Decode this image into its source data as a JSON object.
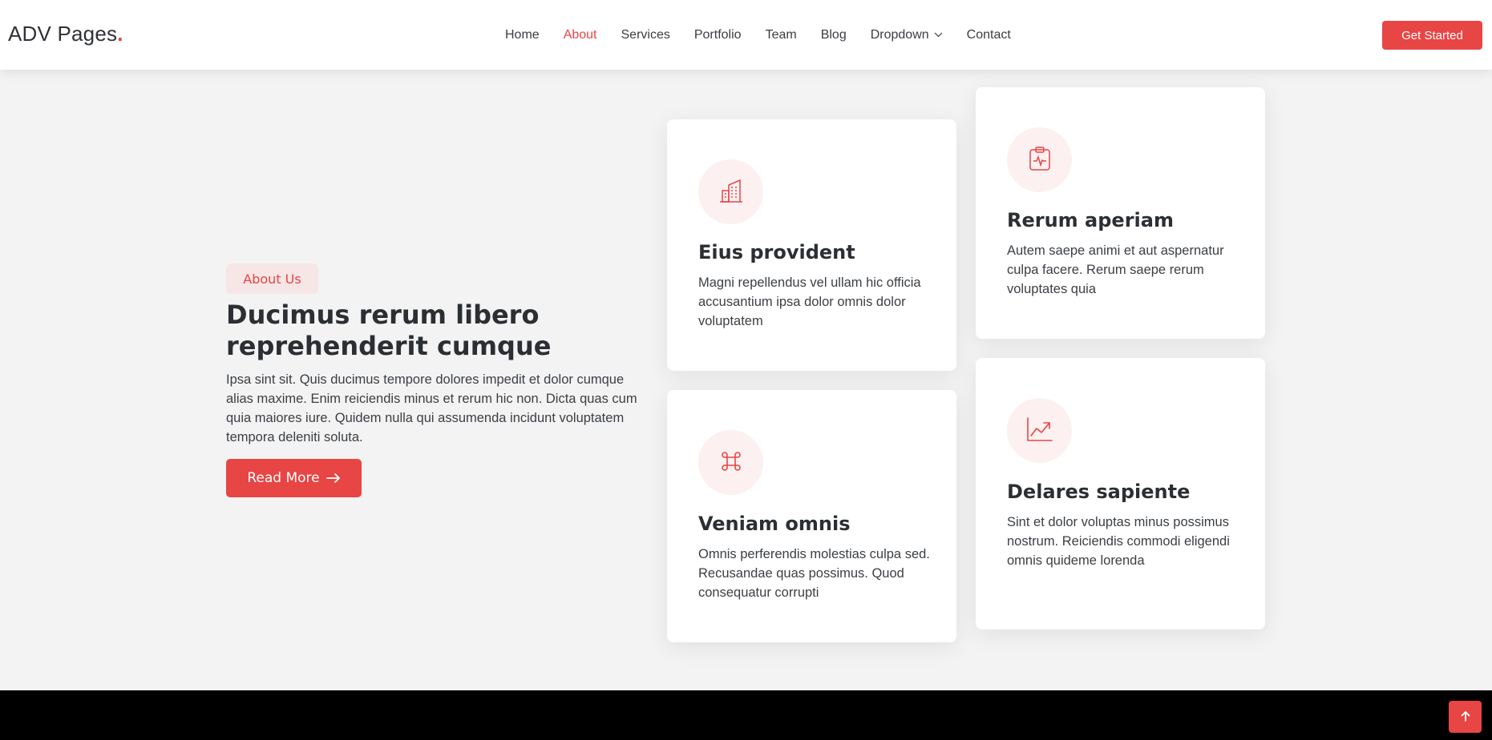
{
  "header": {
    "logo_text": "ADV Pages",
    "logo_dot": ".",
    "nav": [
      {
        "label": "Home",
        "active": false
      },
      {
        "label": "About",
        "active": true
      },
      {
        "label": "Services",
        "active": false
      },
      {
        "label": "Portfolio",
        "active": false
      },
      {
        "label": "Team",
        "active": false
      },
      {
        "label": "Blog",
        "active": false
      },
      {
        "label": "Dropdown",
        "active": false
      },
      {
        "label": "Contact",
        "active": false
      }
    ],
    "cta_label": "Get Started"
  },
  "about": {
    "badge": "About Us",
    "title": "Ducimus rerum libero reprehenderit cumque",
    "text": "Ipsa sint sit. Quis ducimus tempore dolores impedit et dolor cumque alias maxime. Enim reiciendis minus et rerum hic non. Dicta quas cum quia maiores iure. Quidem nulla qui assumenda incidunt voluptatem tempora deleniti soluta.",
    "button_label": "Read More"
  },
  "cards": [
    {
      "icon": "buildings-icon",
      "title": "Eius provident",
      "text": "Magni repellendus vel ullam hic officia accusantium ipsa dolor omnis dolor voluptatem"
    },
    {
      "icon": "clipboard-pulse-icon",
      "title": "Rerum aperiam",
      "text": "Autem saepe animi et aut aspernatur culpa facere. Rerum saepe rerum voluptates quia"
    },
    {
      "icon": "command-icon",
      "title": "Veniam omnis",
      "text": "Omnis perferendis molestias culpa sed. Recusandae quas possimus. Quod consequatur corrupti"
    },
    {
      "icon": "graph-up-arrow-icon",
      "title": "Delares sapiente",
      "text": "Sint et dolor voluptas minus possimus nostrum. Reiciendis commodi eligendi omnis quideme lorenda"
    }
  ],
  "colors": {
    "accent": "#e84545",
    "background": "#f3f3f3",
    "icon_circle": "#fdf0f0",
    "footer": "#000000"
  },
  "scroll_top_icon": "arrow-up-icon"
}
